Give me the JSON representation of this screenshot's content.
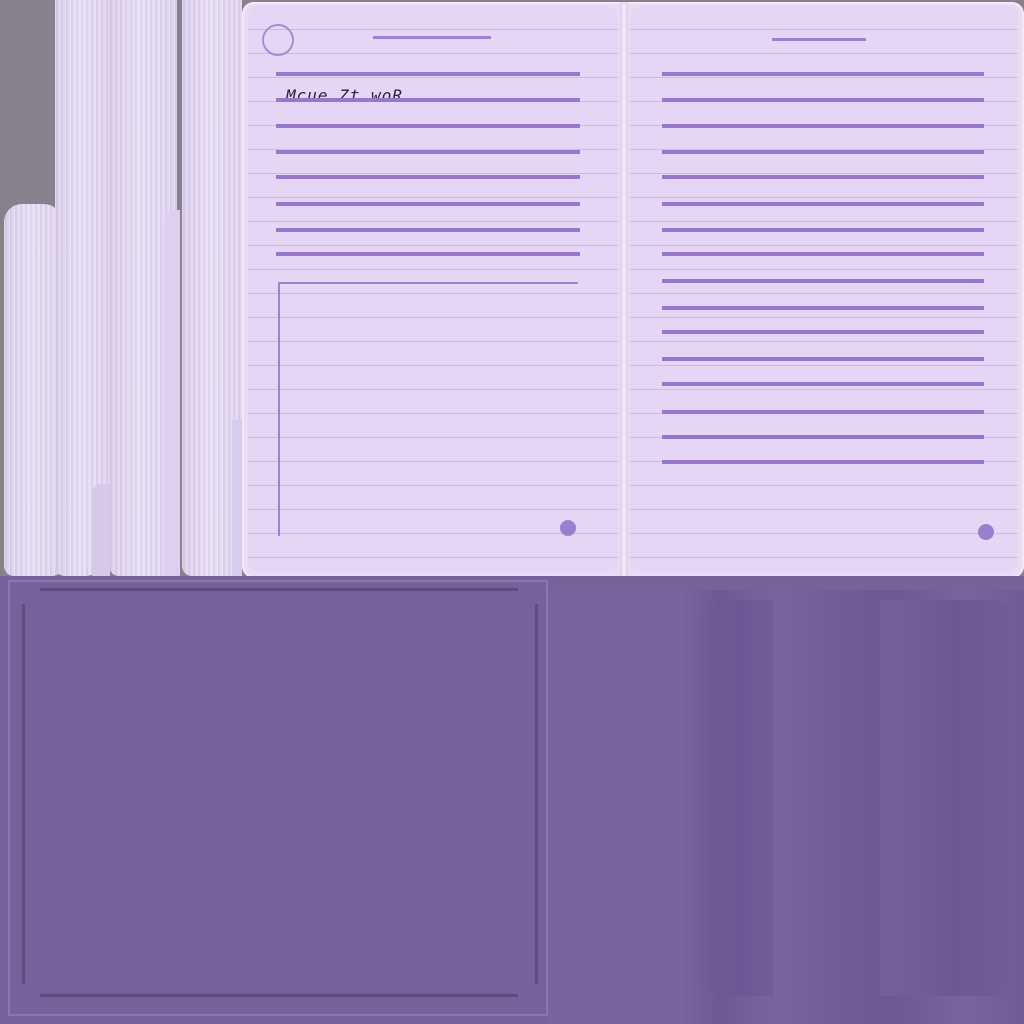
{
  "notebook": {
    "left_page": {
      "handwritten_note": "Mcue Zt.woR."
    }
  },
  "colors": {
    "paper": "#e6d6f5",
    "rule": "#9878cc",
    "cover": "#77629a",
    "background": "#86818a"
  },
  "icons": {
    "punch_hole": "circle-outline",
    "page_marker": "filled-dot"
  }
}
